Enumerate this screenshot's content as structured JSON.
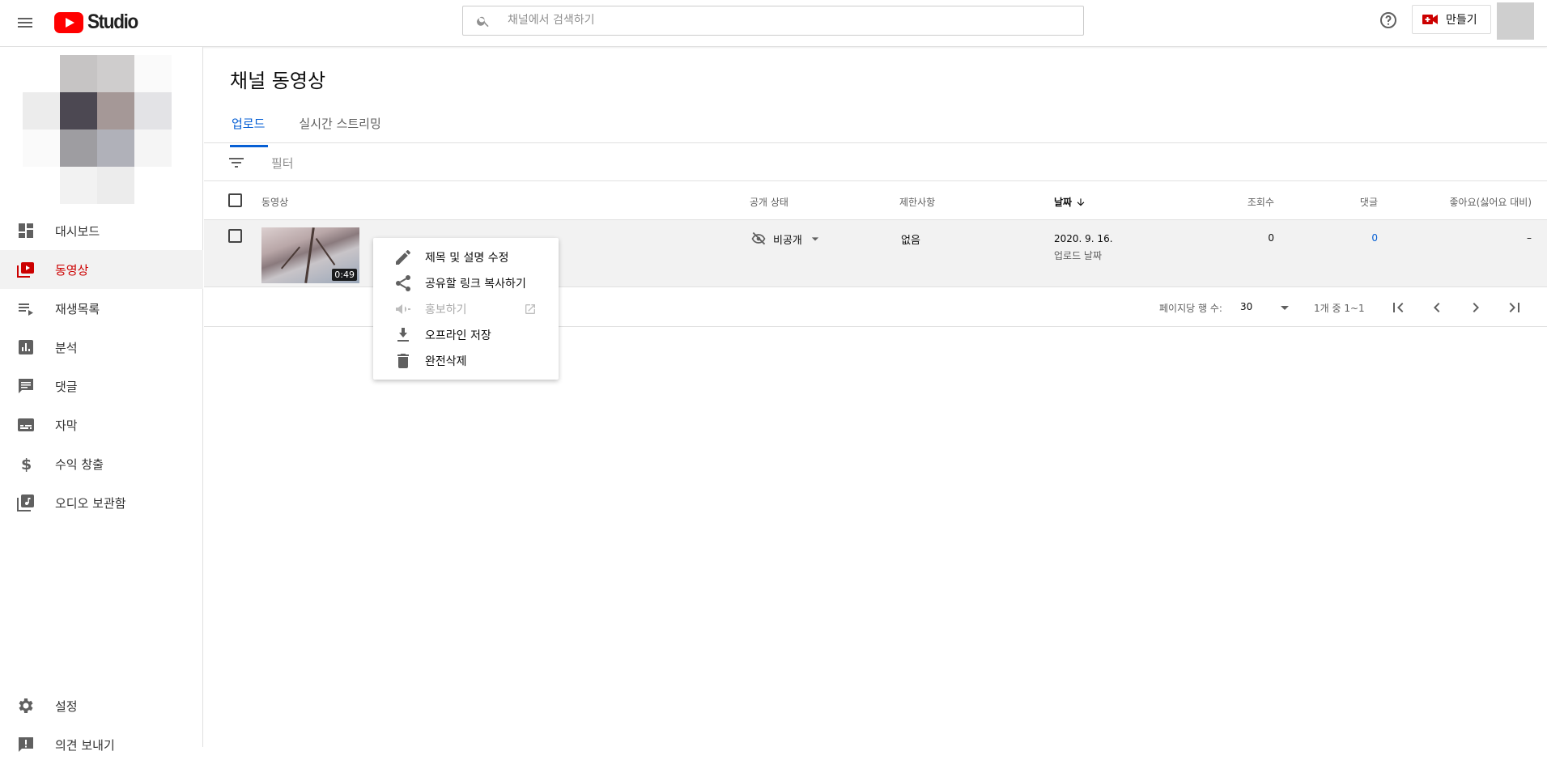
{
  "header": {
    "logo_text": "Studio",
    "search_placeholder": "채널에서 검색하기",
    "create_label": "만들기"
  },
  "sidebar": {
    "items": [
      {
        "label": "대시보드",
        "icon": "dashboard-icon"
      },
      {
        "label": "동영상",
        "icon": "videos-icon",
        "active": true
      },
      {
        "label": "재생목록",
        "icon": "playlist-icon"
      },
      {
        "label": "분석",
        "icon": "analytics-icon"
      },
      {
        "label": "댓글",
        "icon": "comments-icon"
      },
      {
        "label": "자막",
        "icon": "subtitles-icon"
      },
      {
        "label": "수익 창출",
        "icon": "dollar-icon"
      },
      {
        "label": "오디오 보관함",
        "icon": "audio-library-icon"
      }
    ],
    "bottom_items": [
      {
        "label": "설정",
        "icon": "gear-icon"
      },
      {
        "label": "의견 보내기",
        "icon": "feedback-icon"
      }
    ]
  },
  "main": {
    "title": "채널 동영상",
    "tabs": [
      {
        "label": "업로드",
        "active": true
      },
      {
        "label": "실시간 스트리밍"
      }
    ],
    "filter_label": "필터",
    "columns": {
      "video": "동영상",
      "visibility": "공개 상태",
      "restrictions": "제한사항",
      "date": "날짜",
      "views": "조회수",
      "comments": "댓글",
      "likes": "좋아요(싫어요 대비)"
    },
    "rows": [
      {
        "duration": "0:49",
        "visibility": "비공개",
        "restrictions": "없음",
        "date": "2020. 9. 16.",
        "date_sub": "업로드 날짜",
        "views": "0",
        "comments": "0",
        "likes": "–"
      }
    ],
    "pagination": {
      "rows_per_page_label": "페이지당 행 수:",
      "rows_per_page": "30",
      "range": "1개 중 1~1"
    }
  },
  "context_menu": {
    "items": [
      {
        "label": "제목 및 설명 수정",
        "icon": "pencil-icon"
      },
      {
        "label": "공유할 링크 복사하기",
        "icon": "share-icon"
      },
      {
        "label": "홍보하기",
        "icon": "megaphone-icon",
        "disabled": true
      },
      {
        "label": "오프라인 저장",
        "icon": "download-icon"
      },
      {
        "label": "완전삭제",
        "icon": "trash-icon"
      }
    ]
  },
  "colors": {
    "accent": "#065fd4",
    "brand": "#ff0000",
    "active_nav": "#cc0000"
  }
}
